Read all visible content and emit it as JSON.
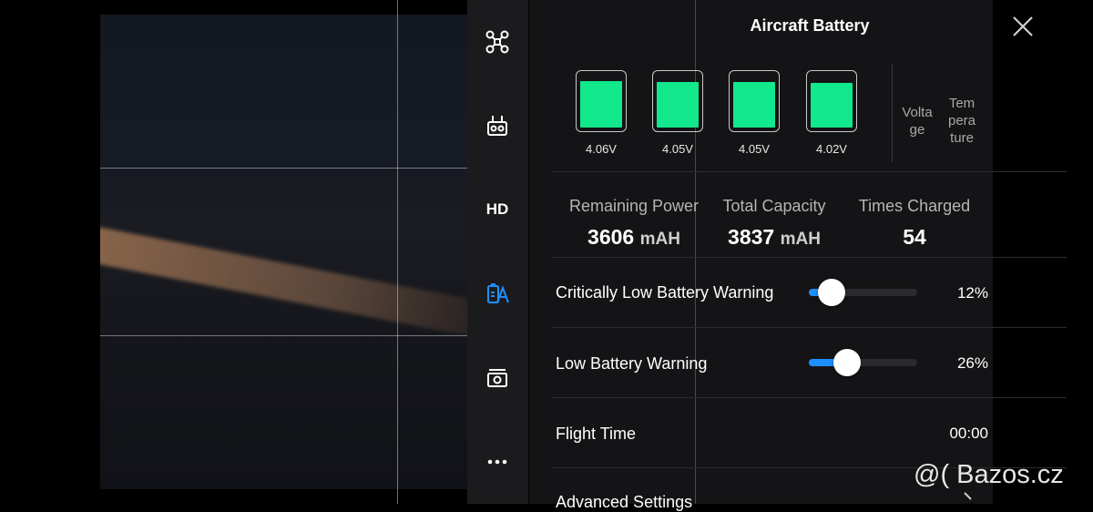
{
  "panel": {
    "title": "Aircraft Battery"
  },
  "sidebar": {
    "items": [
      {
        "name": "aircraft-settings",
        "icon": "drone-icon"
      },
      {
        "name": "remote-controller",
        "icon": "remote-controller-icon"
      },
      {
        "name": "hd-transmission",
        "label": "HD"
      },
      {
        "name": "aircraft-battery",
        "icon": "battery-icon",
        "active": true
      },
      {
        "name": "camera-settings",
        "icon": "camera-icon"
      },
      {
        "name": "more",
        "icon": "more-icon"
      }
    ]
  },
  "battery": {
    "cells": [
      {
        "voltage": "4.06V",
        "level": 0.85
      },
      {
        "voltage": "4.05V",
        "level": 0.84
      },
      {
        "voltage": "4.05V",
        "level": 0.84
      },
      {
        "voltage": "4.02V",
        "level": 0.82
      }
    ],
    "column_labels": {
      "voltage": "Volta\nge",
      "temperature": "Tem\npera\nture"
    },
    "fill_color": "#12e88c"
  },
  "stats": {
    "remaining_power": {
      "label": "Remaining Power",
      "value": "3606",
      "unit": "mAH"
    },
    "total_capacity": {
      "label": "Total Capacity",
      "value": "3837",
      "unit": "mAH"
    },
    "times_charged": {
      "label": "Times Charged",
      "value": "54"
    }
  },
  "settings": {
    "critical_low": {
      "label": "Critically Low Battery Warning",
      "value": "12%",
      "percent": 12
    },
    "low": {
      "label": "Low Battery Warning",
      "value": "26%",
      "percent": 26
    },
    "flight_time": {
      "label": "Flight Time",
      "value": "00:00"
    },
    "advanced": {
      "label": "Advanced Settings"
    }
  },
  "accent_color": "#1e8fff",
  "watermark": "@( Bazos.cz"
}
